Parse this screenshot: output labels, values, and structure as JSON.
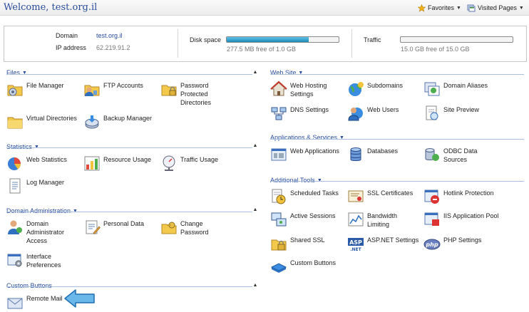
{
  "header": {
    "welcome": "Welcome,  test.org.il",
    "favorites": "Favorites",
    "visited_pages": "Visited Pages"
  },
  "summary": {
    "domain_label": "Domain",
    "domain_value": "test.org.il",
    "ip_label": "IP address",
    "ip_value": "62.219.91.2",
    "disk_label": "Disk space",
    "disk_text": "277.5 MB free of 1.0 GB",
    "disk_used_fraction": 0.73,
    "traffic_label": "Traffic",
    "traffic_text": "15.0 GB free of 15.0 GB",
    "traffic_used_fraction": 0.0
  },
  "sections": {
    "files": {
      "title": "Files",
      "items": [
        "File Manager",
        "FTP Accounts",
        "Password Protected Directories",
        "Virtual Directories",
        "Backup Manager"
      ]
    },
    "statistics": {
      "title": "Statistics",
      "items": [
        "Web Statistics",
        "Resource Usage",
        "Traffic Usage",
        "Log Manager"
      ]
    },
    "domain_admin": {
      "title": "Domain Administration",
      "items": [
        "Domain Administrator Access",
        "Personal Data",
        "Change Password",
        "Interface Preferences"
      ]
    },
    "custom_buttons": {
      "title": "Custom Buttons",
      "items": [
        "Remote Mail"
      ]
    },
    "website": {
      "title": "Web Site",
      "items": [
        "Web Hosting Settings",
        "Subdomains",
        "Domain Aliases",
        "DNS Settings",
        "Web Users",
        "Site Preview"
      ]
    },
    "apps": {
      "title": "Applications & Services",
      "items": [
        "Web Applications",
        "Databases",
        "ODBC Data Sources"
      ]
    },
    "tools": {
      "title": "Additional Tools",
      "items": [
        "Scheduled Tasks",
        "SSL Certificates",
        "Hotlink Protection",
        "Active Sessions",
        "Bandwidth Limiting",
        "IIS Application Pool",
        "Shared SSL",
        "ASP.NET Settings",
        "PHP Settings",
        "Custom Buttons"
      ]
    }
  },
  "icons": {
    "star_color": "#f2b01e",
    "folder_color": "#f3c94b",
    "accent": "#2a4d9c",
    "arrow_color": "#6ab7ea"
  }
}
